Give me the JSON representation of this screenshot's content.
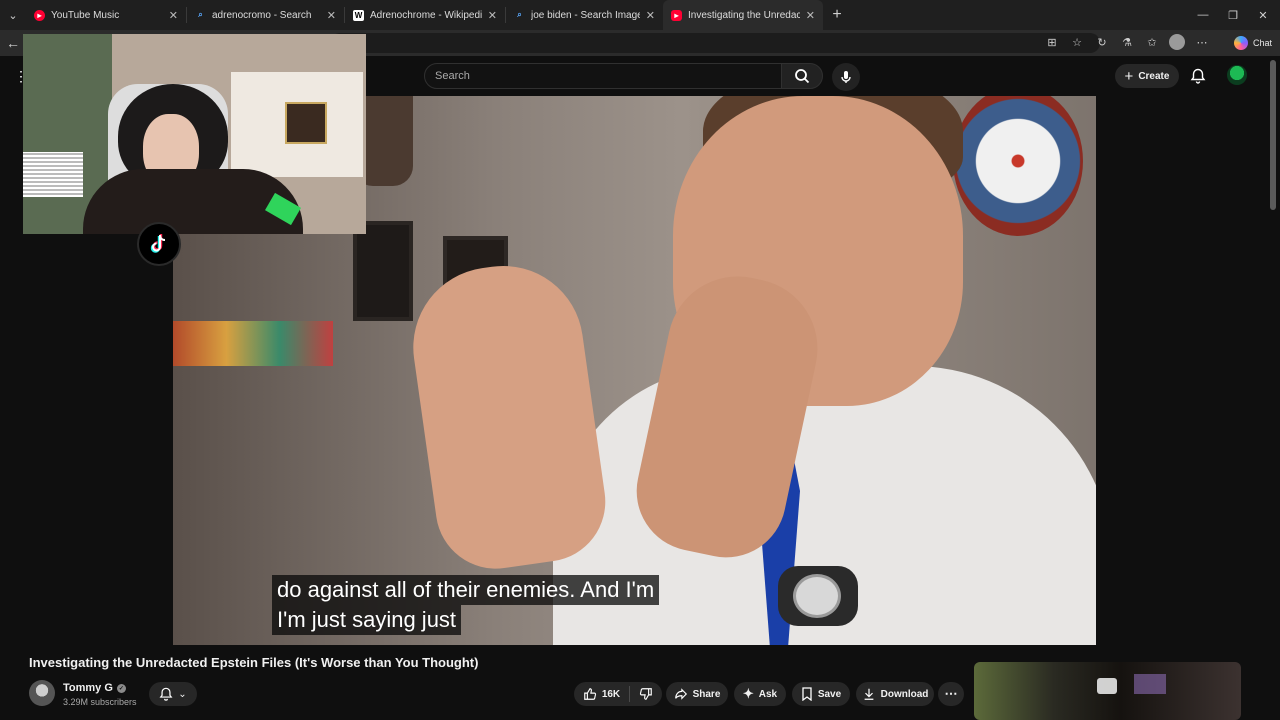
{
  "tabs": [
    {
      "title": "YouTube Music",
      "color": "#ff0033"
    },
    {
      "title": "adrenocromo - Search",
      "color": "#3a8bd1"
    },
    {
      "title": "Adrenochrome - Wikipedia",
      "color": "#ffffff"
    },
    {
      "title": "joe biden - Search Images",
      "color": "#3a8bd1"
    },
    {
      "title": "Investigating the Unredacted Epstein",
      "color": "#ff0033"
    }
  ],
  "browser": {
    "chat_label": "Chat"
  },
  "youtube": {
    "search_placeholder": "Search",
    "create_label": "Create"
  },
  "video": {
    "caption_line1": "do against all of their enemies. And I'm",
    "caption_line2": "I'm just saying just"
  },
  "meta": {
    "title": "Investigating the Unredacted Epstein Files (It's Worse than You Thought)",
    "channel_name": "Tommy G",
    "subscribers": "3.29M subscribers",
    "likes": "16K",
    "share_label": "Share",
    "ask_label": "Ask",
    "save_label": "Save",
    "download_label": "Download"
  }
}
